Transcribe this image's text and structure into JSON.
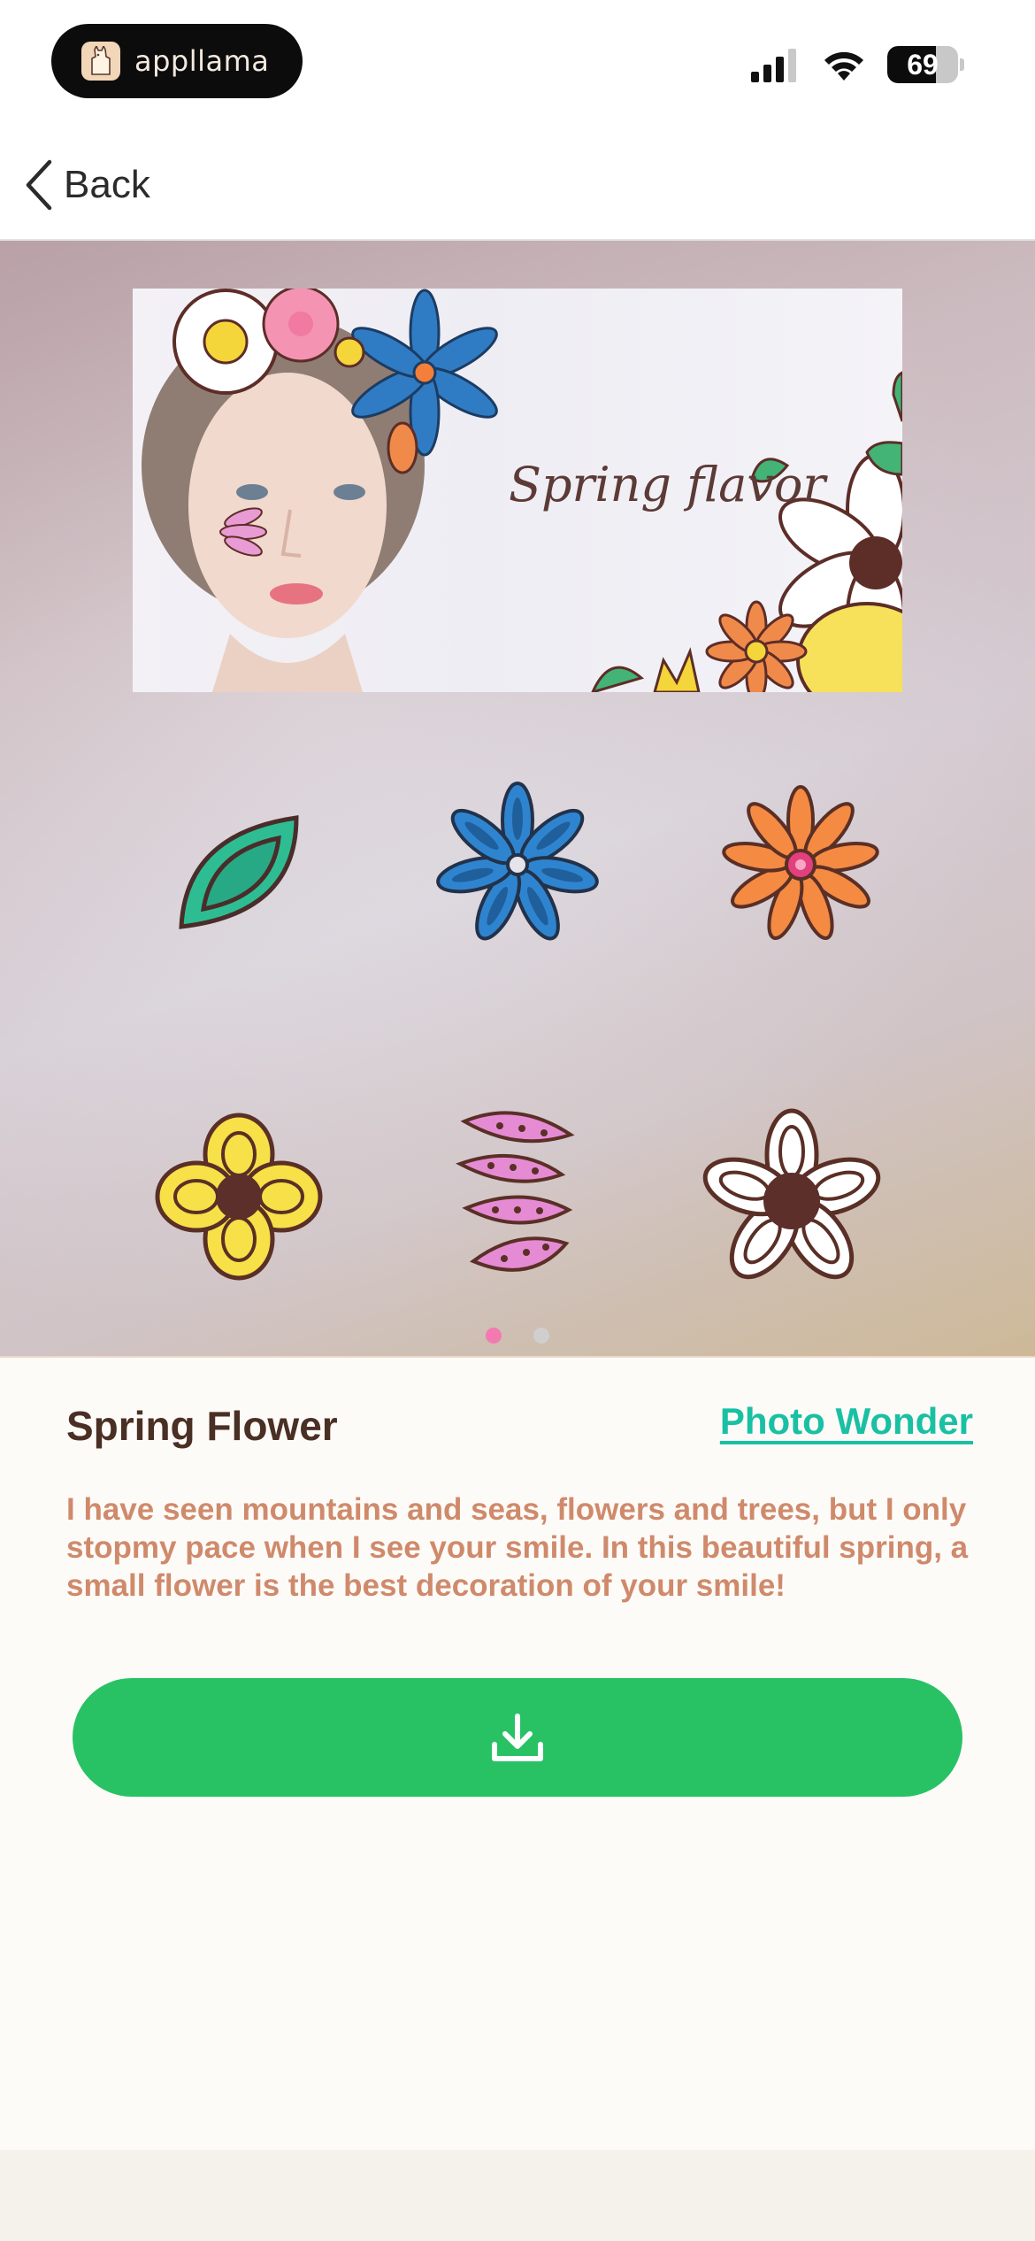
{
  "status_bar": {
    "app_name": "appllama",
    "battery_percent": "69",
    "battery_level": 0.69
  },
  "nav": {
    "back_label": "Back"
  },
  "hero": {
    "banner_title": "Spring flavor",
    "pager": {
      "count": 2,
      "active_index": 0
    },
    "stickers": [
      "leaf-sticker",
      "blue-flower-sticker",
      "orange-flower-sticker",
      "yellow-flower-sticker",
      "pink-leaves-sticker",
      "white-flower-sticker"
    ]
  },
  "detail": {
    "title": "Spring Flower",
    "author": "Photo Wonder",
    "description": "I have seen mountains and seas, flowers and trees, but I only stopmy pace when I see your smile. In this beautiful spring, a small flower is the best decoration of your smile!",
    "download_icon": "download-icon"
  },
  "colors": {
    "accent": "#28c265",
    "link": "#19c0a3",
    "description_text": "#cf8a6b",
    "title_text": "#4a2f24",
    "pager_active": "#f27ab1"
  }
}
